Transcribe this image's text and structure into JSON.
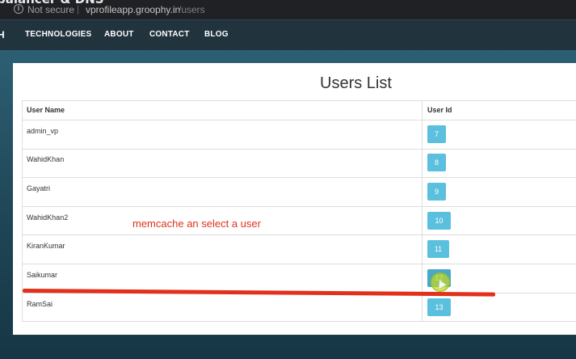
{
  "browser": {
    "title_fragment": "balancer & DNS",
    "security_label": "Not secure",
    "separator": "|",
    "url_host": "vprofileapp.groophy.in",
    "url_path": "/users"
  },
  "navbar": {
    "brand_fragment": "H",
    "links": [
      "TECHNOLOGIES",
      "ABOUT",
      "CONTACT",
      "BLOG"
    ]
  },
  "page": {
    "title": "Users List",
    "columns": [
      "User Name",
      "User Id"
    ],
    "users": [
      {
        "name": "admin_vp",
        "id": "7"
      },
      {
        "name": "WahidKhan",
        "id": "8"
      },
      {
        "name": "Gayatri",
        "id": "9"
      },
      {
        "name": "WahidKhan2",
        "id": "10"
      },
      {
        "name": "KiranKumar",
        "id": "11"
      },
      {
        "name": "Saikumar",
        "id": "12"
      },
      {
        "name": "RamSai",
        "id": "13"
      }
    ]
  },
  "annotation": {
    "text": "memcache an select a user",
    "color": "#e0301e"
  },
  "colors": {
    "navbar": "#21333d",
    "badge": "#5bc0de",
    "highlight_line": "#e2301b"
  }
}
